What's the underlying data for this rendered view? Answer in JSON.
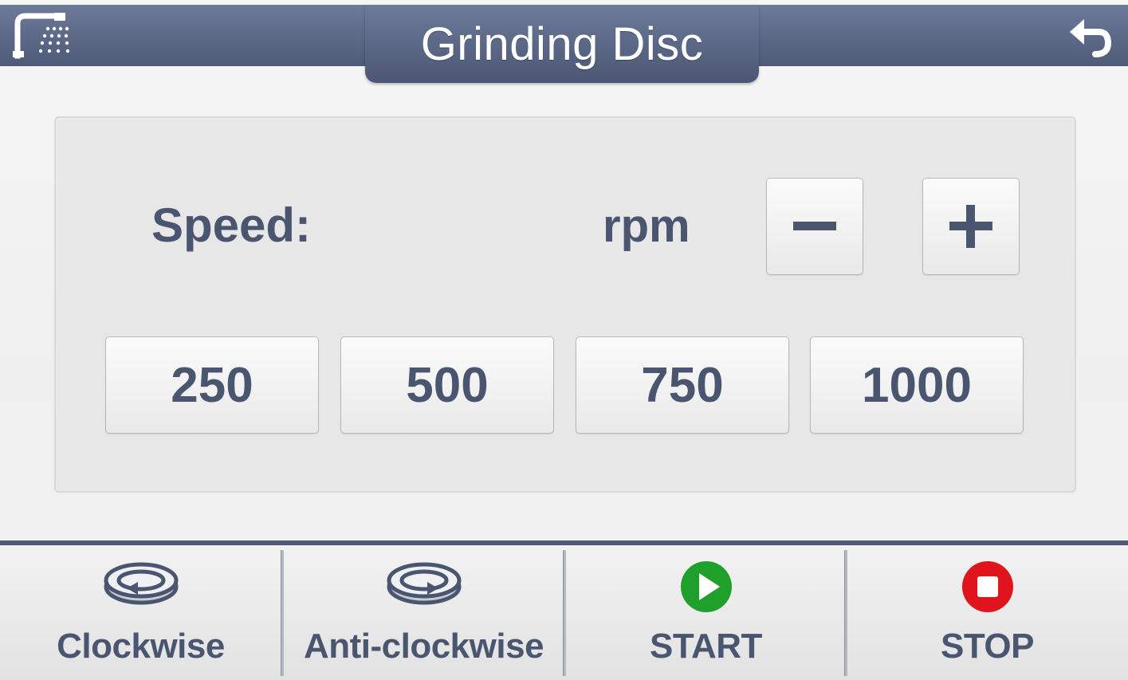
{
  "header": {
    "title": "Grinding Disc"
  },
  "speed": {
    "label": "Speed:",
    "value": "",
    "unit": "rpm",
    "decrement_label": "−",
    "increment_label": "+"
  },
  "presets": [
    "250",
    "500",
    "750",
    "1000"
  ],
  "bottom_bar": {
    "clockwise_label": "Clockwise",
    "anticlockwise_label": "Anti-clockwise",
    "start_label": "START",
    "stop_label": "STOP"
  },
  "colors": {
    "header": "#5a6685",
    "text": "#4a5570",
    "start": "#1fa02a",
    "stop": "#e0141c"
  },
  "icons": {
    "home": "shower-home-icon",
    "back": "back-arrow-icon",
    "clockwise": "clockwise-rotation-icon",
    "anticlockwise": "anticlockwise-rotation-icon",
    "start": "play-icon",
    "stop": "stop-icon"
  }
}
